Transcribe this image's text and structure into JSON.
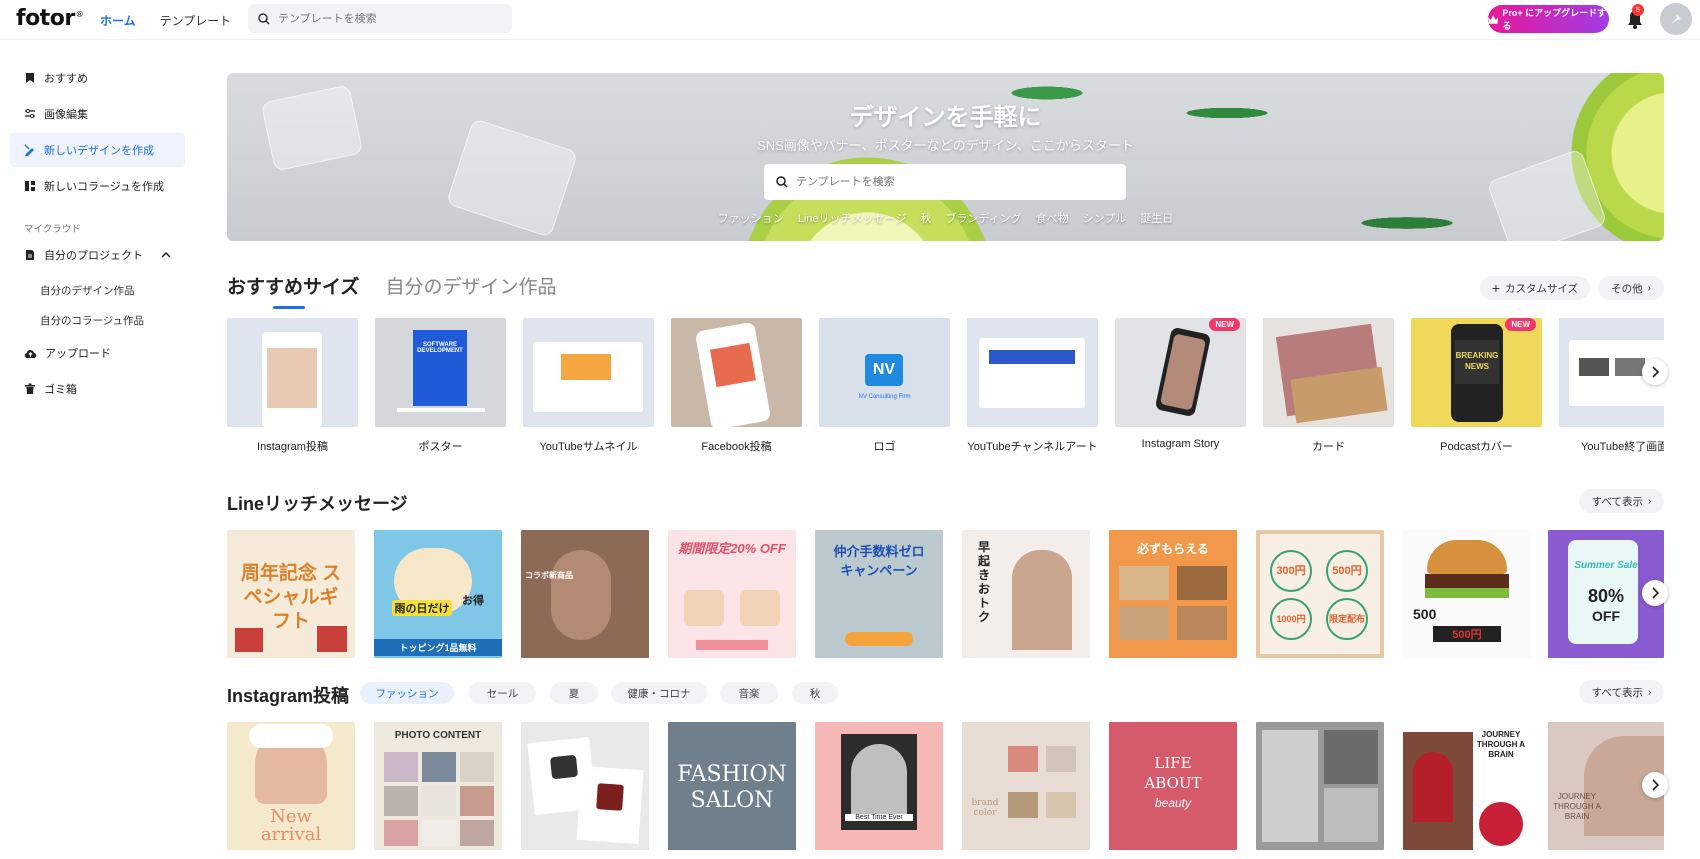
{
  "header": {
    "logo": "fotor",
    "logo_mark": "®",
    "nav": [
      "ホーム",
      "テンプレート"
    ],
    "search_placeholder": "テンプレートを検索",
    "pro_button": "Pro+ にアップグレードする",
    "notification_count": "5"
  },
  "sidebar": {
    "items": [
      "おすすめ",
      "画像編集",
      "新しいデザインを作成",
      "新しいコラージュを作成"
    ],
    "section_label": "マイクラウド",
    "project": "自分のプロジェクト",
    "project_sub": [
      "自分のデザイン作品",
      "自分のコラージュ作品"
    ],
    "bottom_items": [
      "アップロード",
      "ゴミ箱"
    ]
  },
  "hero": {
    "title": "デザインを手軽に",
    "subtitle": "SNS画像やバナー、ポスターなどのデザイン、ここからスタート",
    "search_placeholder": "テンプレートを検索",
    "tags": [
      "ファッション",
      "Lineリッチメッセージ",
      "秋",
      "ブランディング",
      "食べ物",
      "シンプル",
      "誕生日"
    ]
  },
  "sizes": {
    "tabs": [
      "おすすめサイズ",
      "自分のデザイン作品"
    ],
    "custom_button": "カスタムサイズ",
    "more_button": "その他",
    "cards": [
      {
        "label": "Instagram投稿"
      },
      {
        "label": "ポスター"
      },
      {
        "label": "YouTubeサムネイル"
      },
      {
        "label": "Facebook投稿"
      },
      {
        "label": "ロゴ"
      },
      {
        "label": "YouTubeチャンネルアート"
      },
      {
        "label": "Instagram Story",
        "badge": "NEW"
      },
      {
        "label": "カード"
      },
      {
        "label": "Podcastカバー",
        "badge": "NEW"
      },
      {
        "label": "YouTube終了画面"
      }
    ],
    "thumb_texts": {
      "poster": "SOFTWARE DEVELOPMENT",
      "logo": "NV",
      "logo_sub": "NV Consulting Firm",
      "podcast": "BREAKING NEWS"
    }
  },
  "line": {
    "title": "Lineリッチメッセージ",
    "view_all": "すべて表示",
    "texts": {
      "t1": "周年記念 スペシャルギフト",
      "t2a": "雨の日だけ",
      "t2b": "お得",
      "t2c": "トッピング1品無料",
      "t3": "コラボ新商品",
      "t4": "期間限定20% OFF",
      "t5a": "仲介手数料ゼロ",
      "t5b": "キャンペーン",
      "t6": "早起きおトク",
      "t7": "必ずもらえる",
      "t8": [
        "300円",
        "500円",
        "1000円",
        "限定配布"
      ],
      "t9a": "500",
      "t9b": "500円",
      "t10a": "Summer Sale",
      "t10b": "80%",
      "t10c": "OFF"
    }
  },
  "instagram": {
    "title": "Instagram投稿",
    "chips": [
      "ファッション",
      "セール",
      "夏",
      "健康・コロナ",
      "音楽",
      "秋"
    ],
    "view_all": "すべて表示",
    "texts": {
      "i1a": "New",
      "i1b": "arrival",
      "i2": "PHOTO CONTENT",
      "i4a": "FASHION",
      "i4b": "SALON",
      "i5": "Best Time Ever",
      "i6": "brand color",
      "i7a": "LIFE",
      "i7b": "ABOUT",
      "i7c": "beauty",
      "i9": "JOURNEY THROUGH A BRAIN",
      "i10": "JOURNEY THROUGH A BRAIN"
    }
  },
  "colors": {
    "accent": "#1f6feb",
    "pro_gradient_start": "#e6199a",
    "pro_gradient_end": "#a23ce6",
    "new_badge": "#f0386b"
  }
}
